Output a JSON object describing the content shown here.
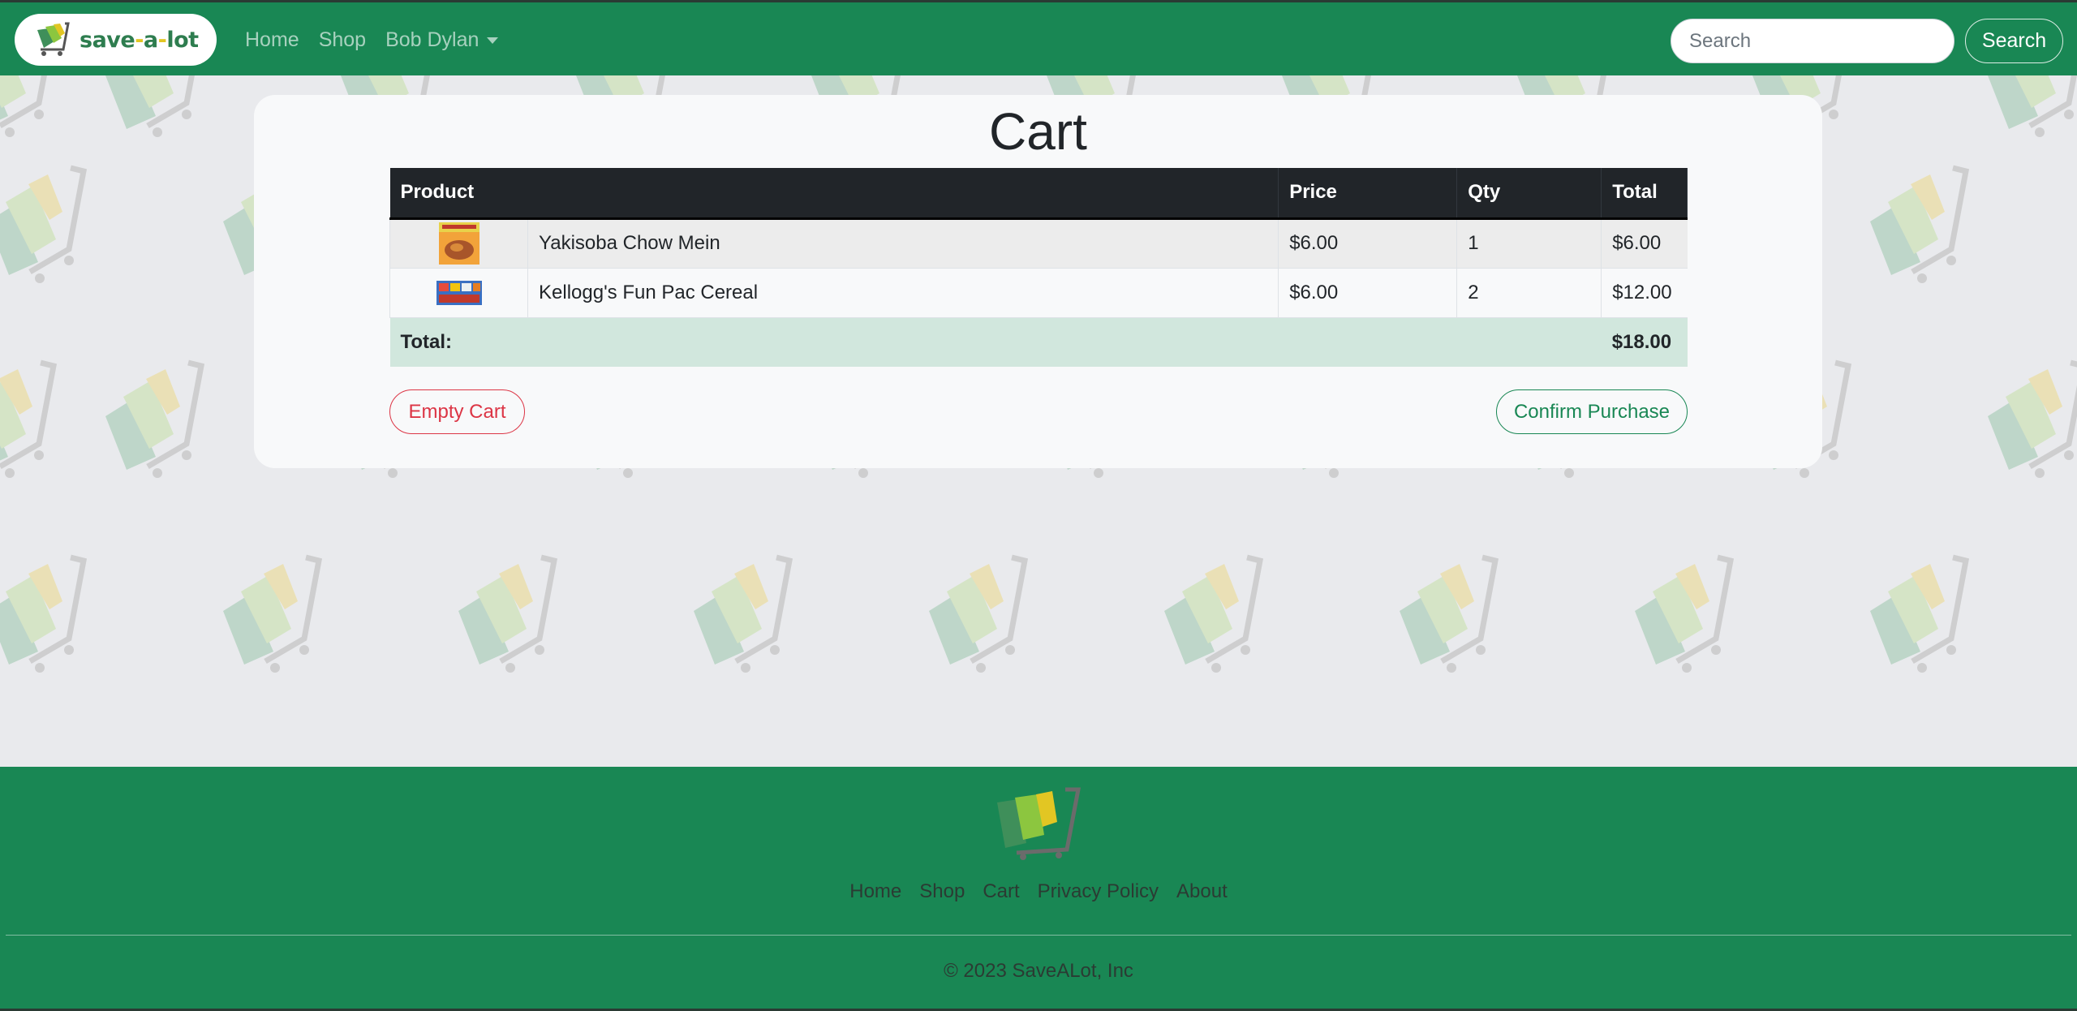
{
  "navbar": {
    "brand_text_a": "save",
    "brand_text_dash1": "-",
    "brand_text_b": "a",
    "brand_text_dash2": "-",
    "brand_text_c": "lot",
    "links": [
      {
        "label": "Home"
      },
      {
        "label": "Shop"
      }
    ],
    "user_menu_label": "Bob Dylan",
    "search_placeholder": "Search",
    "search_button_label": "Search"
  },
  "cart": {
    "title": "Cart",
    "columns": {
      "product": "Product",
      "price": "Price",
      "qty": "Qty",
      "total": "Total"
    },
    "items": [
      {
        "name": "Yakisoba Chow Mein",
        "price": "$6.00",
        "qty": "1",
        "total": "$6.00",
        "thumb_icon": "noodle-box-thumbnail"
      },
      {
        "name": "Kellogg's Fun Pac Cereal",
        "price": "$6.00",
        "qty": "2",
        "total": "$12.00",
        "thumb_icon": "cereal-pack-thumbnail"
      }
    ],
    "total_label": "Total:",
    "grand_total": "$18.00",
    "empty_button_label": "Empty Cart",
    "confirm_button_label": "Confirm Purchase"
  },
  "footer": {
    "links": [
      {
        "label": "Home"
      },
      {
        "label": "Shop"
      },
      {
        "label": "Cart"
      },
      {
        "label": "Privacy Policy"
      },
      {
        "label": "About"
      }
    ],
    "copyright": "© 2023 SaveALot, Inc"
  },
  "colors": {
    "brand_green": "#198754",
    "danger_red": "#dc3545",
    "table_header": "#212529",
    "total_row": "#d1e7dd",
    "logo_yellow": "#e2c623"
  }
}
